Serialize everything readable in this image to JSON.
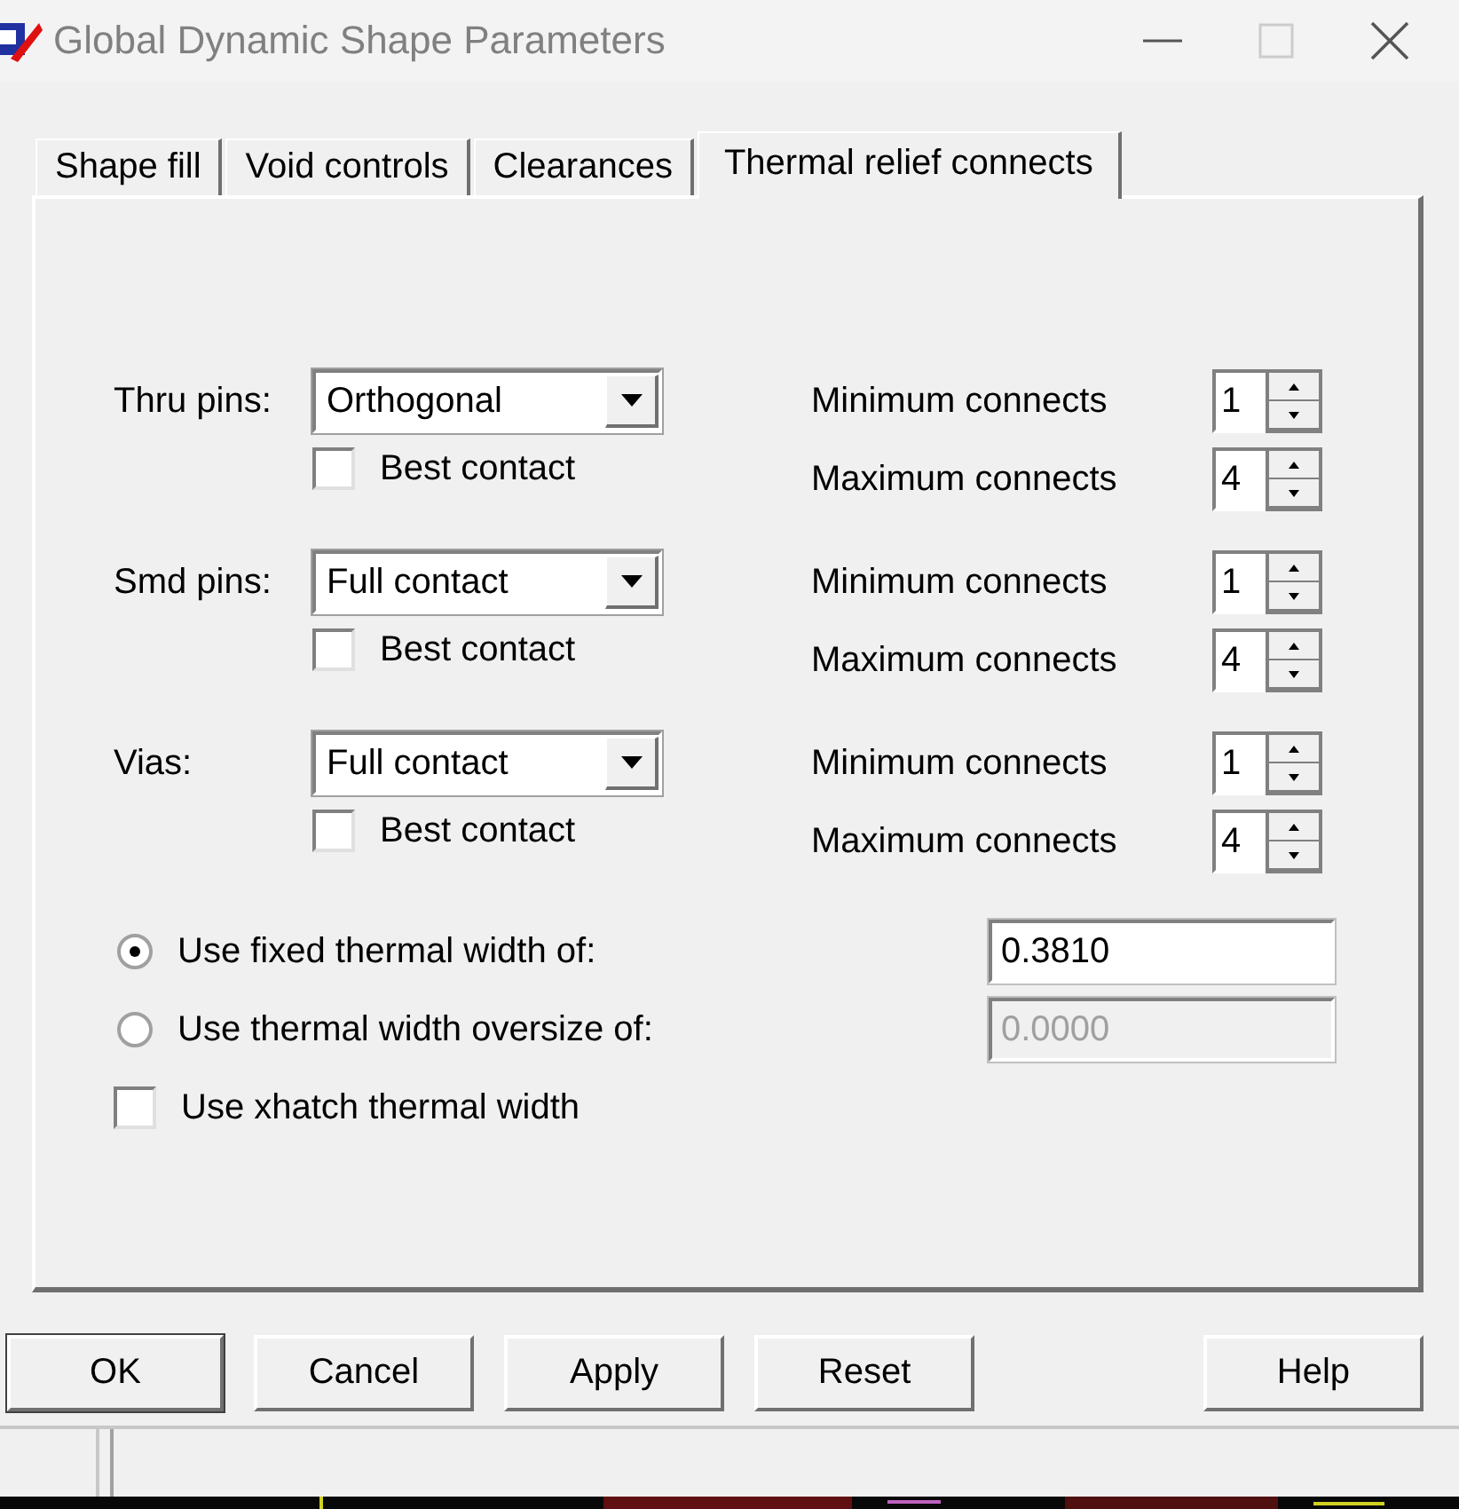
{
  "window": {
    "title": "Global Dynamic Shape Parameters"
  },
  "tabs": [
    {
      "label": "Shape fill",
      "selected": false
    },
    {
      "label": "Void controls",
      "selected": false
    },
    {
      "label": "Clearances",
      "selected": false
    },
    {
      "label": "Thermal relief connects",
      "selected": true
    }
  ],
  "pin_groups": [
    {
      "label": "Thru pins:",
      "combo": "Orthogonal",
      "best_contact": {
        "label": "Best contact",
        "checked": false
      },
      "connects": [
        {
          "label": "Minimum connects",
          "value": "1"
        },
        {
          "label": "Maximum connects",
          "value": "4"
        }
      ]
    },
    {
      "label": "Smd pins:",
      "combo": "Full contact",
      "best_contact": {
        "label": "Best contact",
        "checked": false
      },
      "connects": [
        {
          "label": "Minimum connects",
          "value": "1"
        },
        {
          "label": "Maximum connects",
          "value": "4"
        }
      ]
    },
    {
      "label": "Vias:",
      "combo": "Full contact",
      "best_contact": {
        "label": "Best contact",
        "checked": false
      },
      "connects": [
        {
          "label": "Minimum connects",
          "value": "1"
        },
        {
          "label": "Maximum connects",
          "value": "4"
        }
      ]
    }
  ],
  "width_options": [
    {
      "kind": "radio",
      "label": "Use fixed thermal width of:",
      "selected": true,
      "field": {
        "value": "0.3810",
        "disabled": false
      }
    },
    {
      "kind": "radio",
      "label": "Use thermal width oversize of:",
      "selected": false,
      "field": {
        "value": "0.0000",
        "disabled": true
      }
    },
    {
      "kind": "checkbox",
      "label": "Use xhatch thermal width",
      "checked": false
    }
  ],
  "buttons": [
    {
      "label": "OK",
      "default": true
    },
    {
      "label": "Cancel",
      "default": false
    },
    {
      "label": "Apply",
      "default": false
    },
    {
      "label": "Reset",
      "default": false
    },
    {
      "label": "Help",
      "default": false
    }
  ]
}
